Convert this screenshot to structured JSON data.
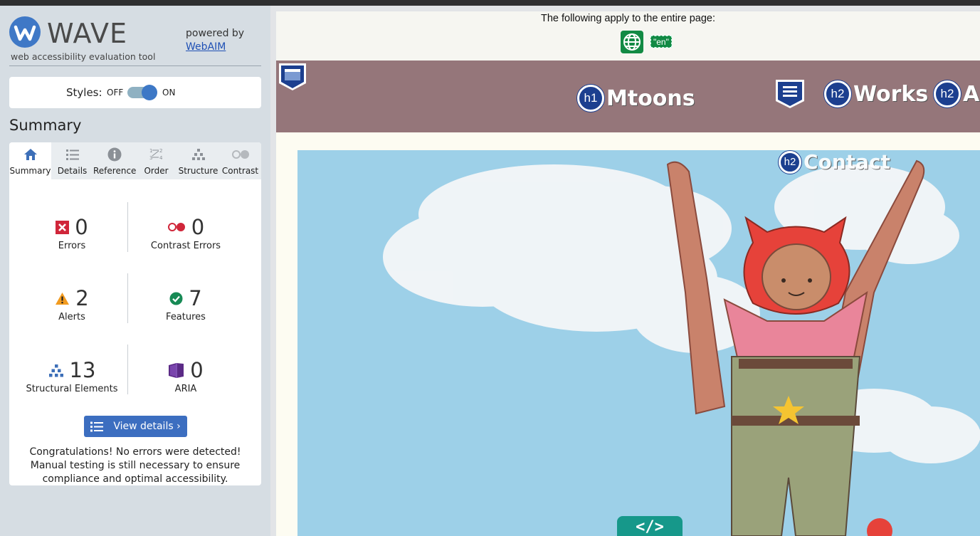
{
  "wave": {
    "logo_text": "WAVE",
    "tagline": "web accessibility evaluation tool",
    "powered_by": "powered by",
    "webaim_link": "WebAIM",
    "styles_label": "Styles:",
    "styles_off": "OFF",
    "styles_on": "ON",
    "summary_heading": "Summary",
    "tabs": [
      {
        "label": "Summary",
        "icon": "home-icon",
        "active": true
      },
      {
        "label": "Details",
        "icon": "list-icon"
      },
      {
        "label": "Reference",
        "icon": "info-icon"
      },
      {
        "label": "Order",
        "icon": "order-icon"
      },
      {
        "label": "Structure",
        "icon": "structure-icon"
      },
      {
        "label": "Contrast",
        "icon": "contrast-icon"
      }
    ],
    "stats": {
      "errors": {
        "count": "0",
        "label": "Errors"
      },
      "contrast_errors": {
        "count": "0",
        "label": "Contrast Errors"
      },
      "alerts": {
        "count": "2",
        "label": "Alerts"
      },
      "features": {
        "count": "7",
        "label": "Features"
      },
      "structural": {
        "count": "13",
        "label": "Structural Elements"
      },
      "aria": {
        "count": "0",
        "label": "ARIA"
      }
    },
    "view_details": "View details ›",
    "congrats": "Congratulations! No errors were detected! Manual testing is still necessary to ensure compliance and optimal accessibility."
  },
  "page": {
    "apply_text": "The following apply to the entire page:",
    "lang_code": "\"en\"",
    "header": {
      "h1_badge": "h1",
      "title": "Mtoons",
      "nav": [
        {
          "badge": "h2",
          "text": "Works"
        },
        {
          "badge": "h2",
          "text": "Al"
        },
        {
          "badge": "h2",
          "text": "Contact"
        }
      ]
    },
    "code_tag": "</>"
  },
  "colors": {
    "wave_blue": "#3d78c6",
    "error_red": "#d0263a",
    "alert_orange": "#f29b1f",
    "feature_green": "#178a55",
    "aria_purple": "#5b2a86",
    "header_mauve": "#95767a",
    "sky": "#9dd0e8"
  }
}
